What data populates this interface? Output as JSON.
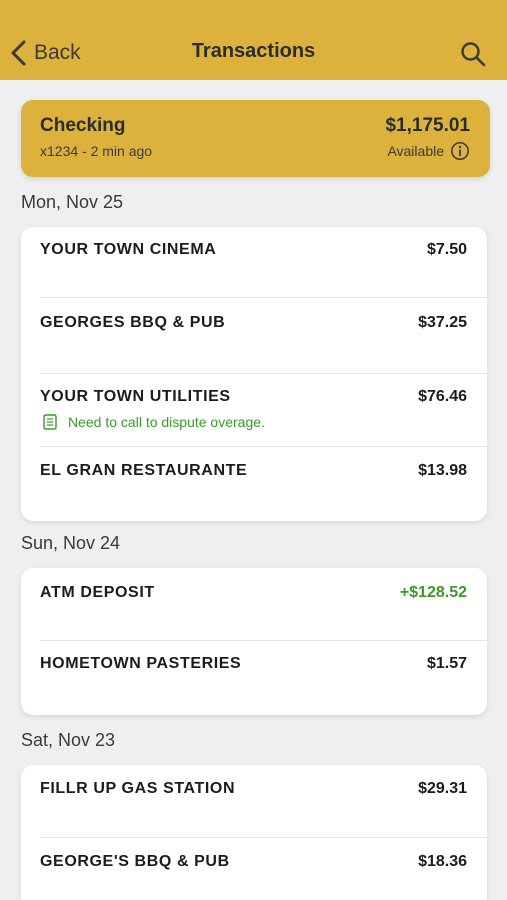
{
  "nav": {
    "back_label": "Back",
    "title": "Transactions"
  },
  "account": {
    "name": "Checking",
    "subtitle": "x1234 - 2 min ago",
    "balance": "$1,175.01",
    "available_label": "Available"
  },
  "groups": [
    {
      "date": "Mon, Nov 25",
      "transactions": [
        {
          "merchant": "YOUR TOWN CINEMA",
          "amount": "$7.50"
        },
        {
          "merchant": "GEORGES BBQ & PUB",
          "amount": "$37.25"
        },
        {
          "merchant": "YOUR TOWN UTILITIES",
          "amount": "$76.46",
          "note": "Need to call to dispute overage."
        },
        {
          "merchant": "EL GRAN RESTAURANTE",
          "amount": "$13.98"
        }
      ]
    },
    {
      "date": "Sun, Nov 24",
      "transactions": [
        {
          "merchant": "ATM DEPOSIT",
          "amount": "+$128.52"
        },
        {
          "merchant": "HOMETOWN PASTERIES",
          "amount": "$1.57"
        }
      ]
    },
    {
      "date": "Sat, Nov 23",
      "transactions": [
        {
          "merchant": "FILLR UP GAS STATION",
          "amount": "$29.31"
        },
        {
          "merchant": "GEORGE'S BBQ & PUB",
          "amount": "$18.36"
        }
      ]
    }
  ],
  "colors": {
    "brand": "#dcb23c",
    "credit": "#3a9a2a",
    "background": "#efefef"
  }
}
